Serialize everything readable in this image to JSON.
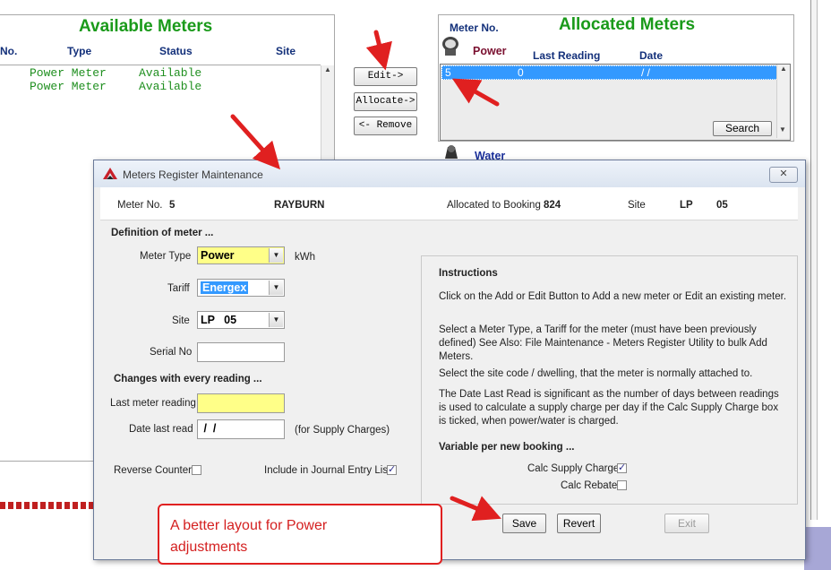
{
  "available_meters": {
    "title": "Available Meters",
    "columns": [
      "No.",
      "Type",
      "Status",
      "Site"
    ],
    "rows": [
      {
        "type": "Power Meter",
        "status": "Available"
      },
      {
        "type": "Power Meter",
        "status": "Available"
      }
    ]
  },
  "middle_buttons": {
    "edit": "Edit->",
    "allocate": "Allocate->",
    "remove": "<- Remove"
  },
  "allocated_meters": {
    "title": "Allocated Meters",
    "meter_no_label": "Meter No.",
    "power_label": "Power",
    "last_reading_label": "Last Reading",
    "date_label": "Date",
    "selected_row": {
      "meter_no": "5",
      "reading": "0",
      "date": "/  /"
    },
    "search_button": "Search",
    "water_label": "Water"
  },
  "dialog": {
    "title": "Meters Register Maintenance",
    "close_glyph": "✕",
    "header": {
      "meter_no_label": "Meter No.",
      "meter_no_value": "5",
      "name": "RAYBURN",
      "allocated_label": "Allocated to Booking",
      "allocated_value": "824",
      "site_label": "Site",
      "site_code": "LP",
      "site_num": "05"
    },
    "definition": {
      "heading": "Definition of meter ...",
      "meter_type_label": "Meter Type",
      "meter_type_value": "Power",
      "unit": "kWh",
      "tariff_label": "Tariff",
      "tariff_value": "Energex",
      "site_label": "Site",
      "site_value": "LP   05",
      "serial_label": "Serial No",
      "serial_value": ""
    },
    "changes": {
      "heading": "Changes with every reading ...",
      "last_reading_label": "Last meter reading",
      "last_reading_value": "",
      "date_last_read_label": "Date last read",
      "date_last_read_value": " /  /",
      "supply_note": "(for Supply Charges)"
    },
    "reverse_counter_label": "Reverse Counter",
    "reverse_counter_checked": false,
    "journal_label": "Include in Journal Entry List",
    "journal_checked": true,
    "instructions": {
      "heading": "Instructions",
      "p1": "Click on the Add or Edit Button to Add a new meter or Edit an existing meter.",
      "p2": "Select a Meter Type, a Tariff for the meter (must have been previously defined) See Also: File Maintenance - Meters Register Utility to bulk Add Meters.",
      "p3": "Select the site code / dwelling, that the meter is normally attached to.",
      "p4": "The Date Last Read is significant as the number of days between readings is used to calculate a supply charge per day if the Calc Supply Charge box is ticked, when power/water is charged.",
      "variable_heading": "Variable per new booking ...",
      "calc_supply_label": "Calc Supply Charge",
      "calc_supply_checked": true,
      "calc_rebate_label": "Calc Rebate",
      "calc_rebate_checked": false
    },
    "buttons": {
      "save": "Save",
      "revert": "Revert",
      "exit": "Exit"
    }
  },
  "callout": {
    "line1": "A better layout for Power",
    "line2": "adjustments"
  },
  "colors": {
    "title_green": "#1a9a1a",
    "header_navy": "#13307a",
    "highlight_blue": "#3399ff",
    "field_yellow": "#ffff88",
    "arrow_red": "#e02020"
  }
}
